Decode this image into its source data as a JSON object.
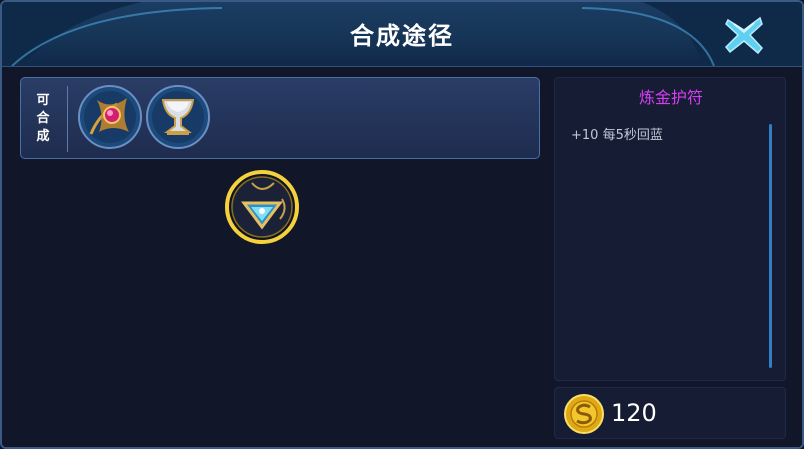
{
  "header": {
    "title": "合成途径"
  },
  "recipe": {
    "label_chars": [
      "可",
      "合",
      "成"
    ],
    "items": [
      {
        "icon": "magic-scepter-icon"
      },
      {
        "icon": "silver-goblet-icon"
      }
    ]
  },
  "selected_item": {
    "icon": "alchemy-amulet-icon",
    "name": "炼金护符",
    "stats": [
      "+10 每5秒回蓝"
    ],
    "price": "120",
    "currency_icon": "gold-coin-icon"
  },
  "colors": {
    "item_name": "#d63ef2",
    "frame_gold": "#f5d23c",
    "scrollbar": "#2f7fc2",
    "close_cyan": "#5fd0f2"
  }
}
